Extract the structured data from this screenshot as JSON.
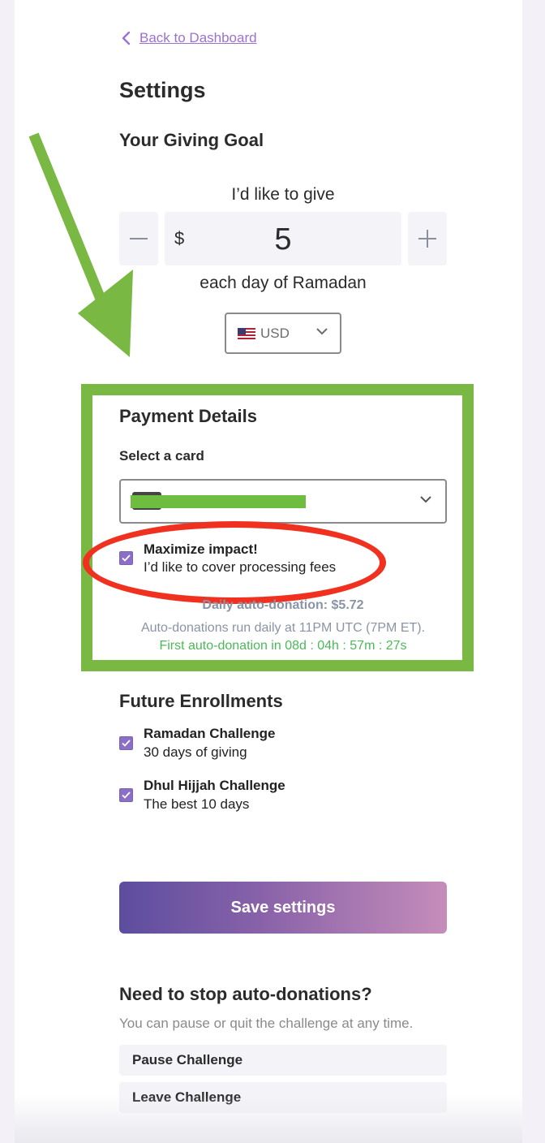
{
  "nav": {
    "back_label": "Back to Dashboard"
  },
  "page_title": "Settings",
  "giving_goal": {
    "heading": "Your Giving Goal",
    "intro": "I’d like to give",
    "currency_symbol": "$",
    "amount": "5",
    "suffix": "each day of Ramadan",
    "currency": {
      "flag": "us-flag-icon",
      "code": "USD"
    }
  },
  "payment": {
    "heading": "Payment Details",
    "select_label": "Select a card",
    "maximize": {
      "title": "Maximize impact!",
      "subtitle": "I’d like to cover processing fees",
      "checked": true
    },
    "daily_auto_donation": "Daily auto-donation: $5.72",
    "schedule_note": "Auto-donations run daily at 11PM UTC (7PM ET).",
    "countdown": "First auto-donation in 08d : 04h : 57m : 27s"
  },
  "future": {
    "heading": "Future Enrollments",
    "items": [
      {
        "title": "Ramadan Challenge",
        "subtitle": "30 days of giving",
        "checked": true
      },
      {
        "title": "Dhul Hijjah Challenge",
        "subtitle": "The best 10 days",
        "checked": true
      }
    ]
  },
  "save_label": "Save settings",
  "stop": {
    "heading": "Need to stop auto-donations?",
    "note": "You can pause or quit the challenge at any time.",
    "pause_label": "Pause Challenge",
    "leave_label": "Leave Challenge"
  },
  "colors": {
    "accent": "#9b72cf",
    "annotation_green": "#78b843",
    "annotation_red": "#f0311f",
    "countdown_green": "#4cb85a",
    "muted_text": "#8a94a6"
  }
}
